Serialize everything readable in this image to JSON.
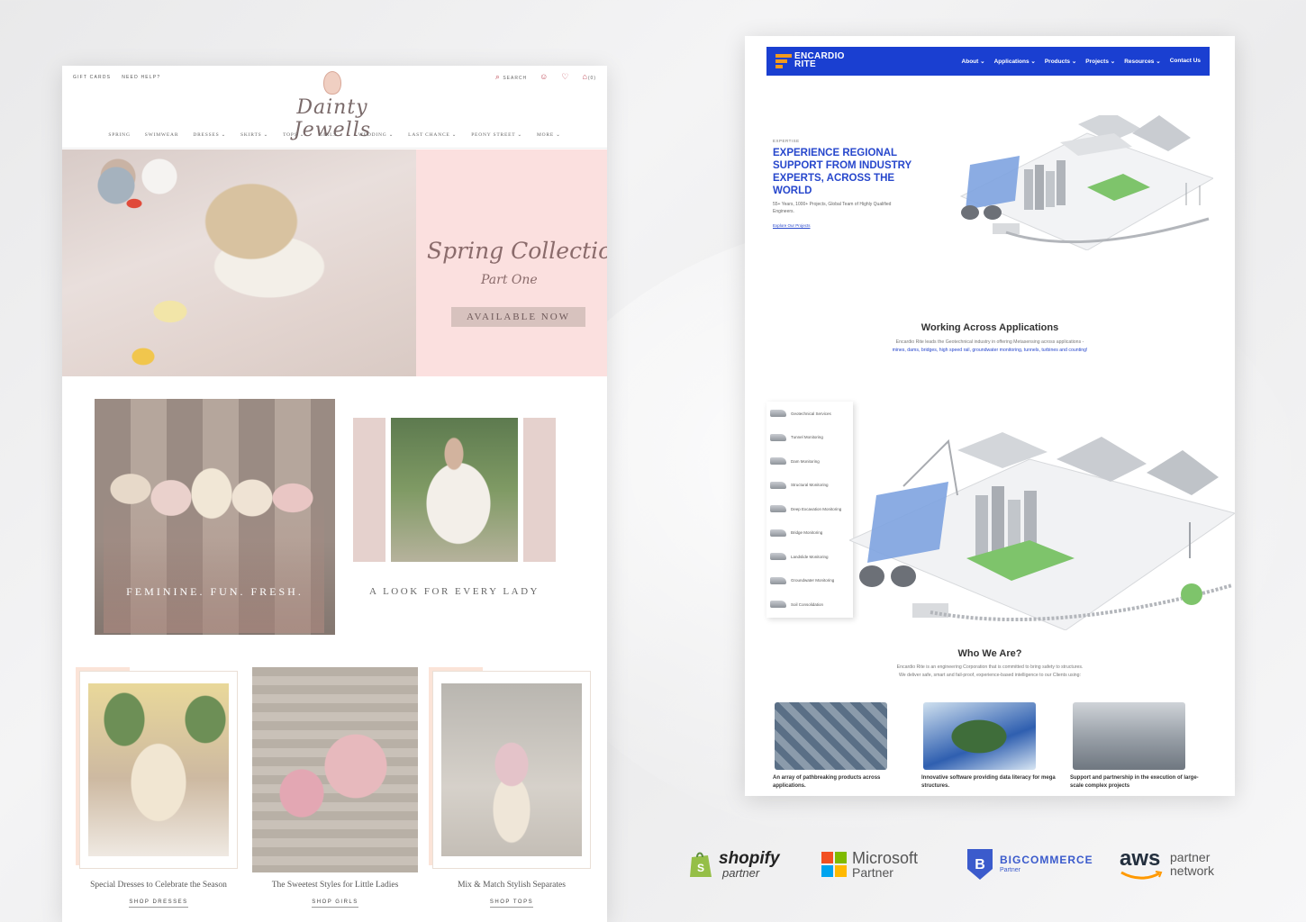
{
  "dainty": {
    "util_links": [
      "GIFT CARDS",
      "NEED HELP?"
    ],
    "search_label": "SEARCH",
    "cart_count": "(0)",
    "logo_text": "Dainty Jewells",
    "nav": [
      "SPRING",
      "SWIMWEAR",
      "DRESSES ⌄",
      "SKIRTS ⌄",
      "TOPS ⌄",
      "GIRLS ⌄",
      "WEDDING ⌄",
      "LAST CHANCE ⌄",
      "PEONY STREET ⌄",
      "MORE ⌄"
    ],
    "hero": {
      "script_line1": "Spring Collection",
      "script_line2": "Part One",
      "cta": "AVAILABLE NOW"
    },
    "tile1_caption": "FEMININE. FUN. FRESH.",
    "tile2_caption": "A LOOK FOR EVERY LADY",
    "cards": [
      {
        "title": "Special Dresses to Celebrate the Season",
        "link": "SHOP DRESSES"
      },
      {
        "title": "The Sweetest Styles for Little Ladies",
        "link": "SHOP GIRLS"
      },
      {
        "title": "Mix & Match Stylish Separates",
        "link": "SHOP TOPS"
      }
    ]
  },
  "encardio": {
    "logo_line1": "ENCARDIO",
    "logo_line2": "RITE",
    "menu": [
      "About ⌄",
      "Applications ⌄",
      "Products ⌄",
      "Projects ⌄",
      "Resources ⌄",
      "Contact Us"
    ],
    "eyebrow": "EXPERTISE",
    "headline": "EXPERIENCE REGIONAL SUPPORT FROM INDUSTRY EXPERTS, ACROSS THE WORLD",
    "subtext": "55+ Years, 1000+ Projects, Global Team of Highly Qualified Engineers.",
    "link": "Explore Our Projects",
    "apps_title": "Working Across Applications",
    "apps_text": "Encardio Rite leads the Geotechnical industry in offering Metasensing across applications -",
    "apps_text_blue": "mines, dams, bridges, high speed rail, groundwater monitoring, tunnels, turbines and counting!",
    "side_items": [
      "Geotechnical Services",
      "Tunnel Monitoring",
      "Dam Monitoring",
      "Structural Monitoring",
      "Deep Excavation Monitoring",
      "Bridge Monitoring",
      "Landslide Monitoring",
      "Groundwater Monitoring",
      "Soil Consolidation"
    ],
    "who_title": "Who We Are?",
    "who_text1": "Encardio Rite is an engineering Corporation that is committed to bring safety to structures.",
    "who_text2": "We deliver safe, smart and fail-proof, experience-based intelligence to our Clients using:",
    "cards": [
      "An array of pathbreaking products across applications.",
      "Innovative software providing data literacy for mega structures.",
      "Support and partnership in the execution of large-scale complex projects"
    ]
  },
  "partners": {
    "shopify": {
      "name": "shopify",
      "sub": "partner"
    },
    "microsoft": {
      "name": "Microsoft",
      "sub": "Partner"
    },
    "bigcommerce": {
      "name": "BIGCOMMERCE",
      "sub": "Partner"
    },
    "aws": {
      "name": "aws",
      "line1": "partner",
      "line2": "network"
    }
  },
  "colors": {
    "encardio_blue": "#1a3fd1",
    "dainty_pink": "#fbe0df",
    "shopify_green": "#95bf47",
    "bigcommerce_blue": "#3b5bcc",
    "aws_orange": "#ff9900"
  }
}
